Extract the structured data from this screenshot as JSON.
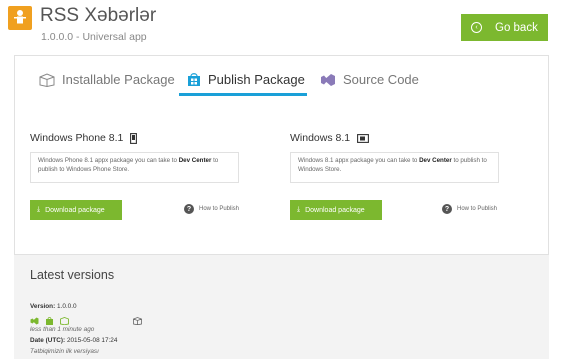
{
  "header": {
    "title": "RSS Xəbərlər",
    "subtitle": "1.0.0.0 - Universal app",
    "go_back_label": "Go back"
  },
  "tabs": [
    {
      "label": "Installable Package",
      "icon": "package-icon",
      "active": false
    },
    {
      "label": "Publish Package",
      "icon": "store-bag-icon",
      "active": true
    },
    {
      "label": "Source Code",
      "icon": "visual-studio-icon",
      "active": false
    }
  ],
  "publish": {
    "phone": {
      "title": "Windows Phone 8.1",
      "desc_pre": "Windows Phone 8.1 appx package you can take to ",
      "desc_bold": "Dev Center",
      "desc_post": " to publish to Windows Phone Store.",
      "download_label": "Download package",
      "how_label": "How to Publish"
    },
    "windows": {
      "title": "Windows 8.1",
      "desc_pre": "Windows 8.1 appx package you can take to ",
      "desc_bold": "Dev Center",
      "desc_post": " to publish to Windows Store.",
      "download_label": "Download package",
      "how_label": "How to Publish"
    }
  },
  "versions": {
    "heading": "Latest versions",
    "version_label": "Version:",
    "version_value": "1.0.0.0",
    "time_ago": "less than 1 minute ago",
    "date_label": "Date (UTC):",
    "date_value": "2015-05-08 17:24",
    "note": "Tətbiqimizin ilk versiyası"
  },
  "colors": {
    "accent_green": "#7cb82f",
    "tab_underline": "#1aa0d8",
    "versions_bg": "#f3f3f3"
  }
}
